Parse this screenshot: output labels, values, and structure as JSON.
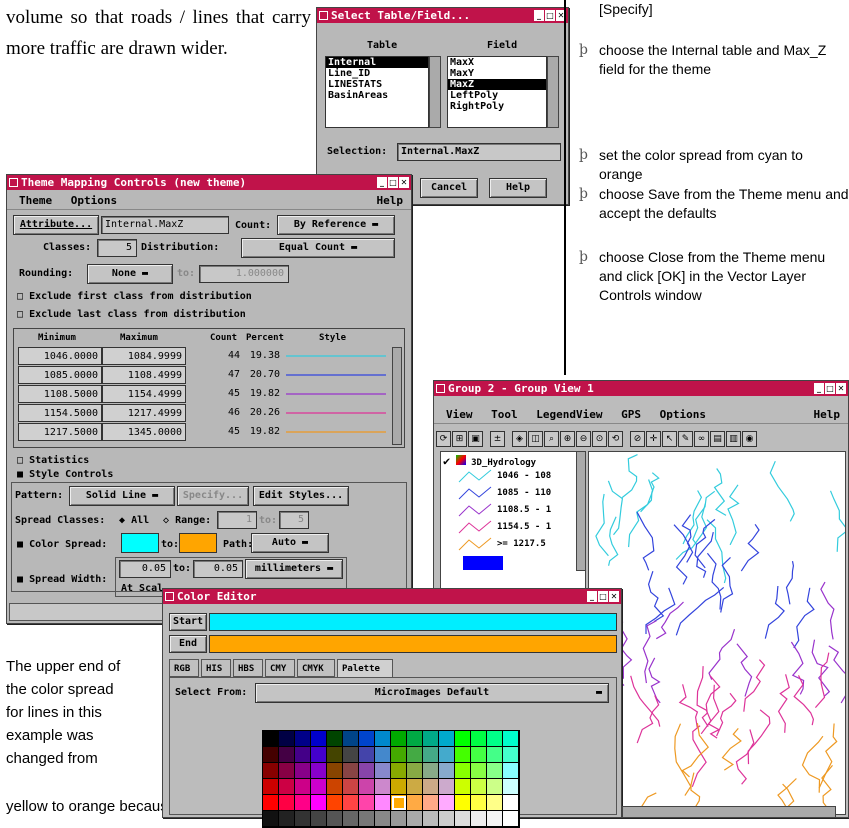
{
  "intro_text": "volume so that roads / lines that carry more traffic are drawn wider.",
  "bottom_text": "The upper end of the color spread for lines in this example was changed from",
  "bottom_text2": "yellow to orange because yellow lines on a",
  "right_text": {
    "specify": "[Specify]",
    "bullets": [
      "choose the Internal table and Max_Z field for the theme",
      "set the color spread from cyan to orange",
      "choose Save from the Theme menu and accept the defaults",
      "choose Close from the Theme menu and click [OK] in the Vector Layer Controls window"
    ],
    "bullet_mark": "þ"
  },
  "select_dialog": {
    "title": "Select Table/Field...",
    "table_header": "Table",
    "field_header": "Field",
    "tables": [
      "Internal",
      "Line_ID",
      "LINESTATS",
      "BasinAreas"
    ],
    "selected_table": "Internal",
    "fields": [
      "MaxX",
      "MaxY",
      "MaxZ",
      "LeftPoly",
      "RightPoly"
    ],
    "selected_field": "MaxZ",
    "selection_label": "Selection:",
    "selection_value": "Internal.MaxZ",
    "cancel": "Cancel",
    "help": "Help"
  },
  "theme_dialog": {
    "title": "Theme Mapping Controls (new theme)",
    "menu": [
      "Theme",
      "Options"
    ],
    "help": "Help",
    "attribute_btn": "Attribute...",
    "attribute_value": "Internal.MaxZ",
    "count_label": "Count:",
    "count_value": "By Reference",
    "classes_label": "Classes:",
    "classes_value": "5",
    "distribution_label": "Distribution:",
    "distribution_value": "Equal Count",
    "rounding_label": "Rounding:",
    "rounding_value": "None",
    "to_label": "to:",
    "rounding_to": "1.000000",
    "exclude_first": "Exclude first class from distribution",
    "exclude_last": "Exclude last class from distribution",
    "headers": [
      "Minimum",
      "Maximum",
      "Count",
      "Percent",
      "Style"
    ],
    "rows": [
      {
        "min": "1046.0000",
        "max": "1084.9999",
        "count": "44",
        "pct": "19.38",
        "color": "#33ccdd"
      },
      {
        "min": "1085.0000",
        "max": "1108.4999",
        "count": "47",
        "pct": "20.70",
        "color": "#3344dd"
      },
      {
        "min": "1108.5000",
        "max": "1154.4999",
        "count": "45",
        "pct": "19.82",
        "color": "#9933cc"
      },
      {
        "min": "1154.5000",
        "max": "1217.4999",
        "count": "46",
        "pct": "20.26",
        "color": "#dd3399"
      },
      {
        "min": "1217.5000",
        "max": "1345.0000",
        "count": "45",
        "pct": "19.82",
        "color": "#ee9922"
      }
    ],
    "statistics": "Statistics",
    "style_controls": "Style Controls",
    "pattern_label": "Pattern:",
    "pattern_value": "Solid Line",
    "specify_btn": "Specify...",
    "edit_styles_btn": "Edit Styles...",
    "spread_classes_label": "Spread Classes:",
    "all_label": "All",
    "range_label": "Range:",
    "range_from": "1",
    "range_to_label": "to:",
    "range_to": "5",
    "color_spread_label": "Color Spread:",
    "color_from": "#00ffff",
    "color_to": "#ffa500",
    "path_label": "Path:",
    "path_value": "Auto",
    "spread_width_label": "Spread Width:",
    "width_from": "0.05",
    "width_to_label": "to:",
    "width_to": "0.05",
    "width_units": "millimeters",
    "at_scale_label": "At Scal"
  },
  "group_dialog": {
    "title": "Group 2 - Group View 1",
    "menu": [
      "View",
      "Tool",
      "LegendView",
      "GPS",
      "Options"
    ],
    "help": "Help",
    "layer_name": "3D_Hydrology",
    "legend": [
      {
        "label": "1046 - 108",
        "color": "#33ccdd"
      },
      {
        "label": "1085 - 110",
        "color": "#3344dd"
      },
      {
        "label": "1108.5 - 1",
        "color": "#9933cc"
      },
      {
        "label": "1154.5 - 1",
        "color": "#dd3399"
      },
      {
        "label": ">= 1217.5",
        "color": "#ee9922"
      }
    ],
    "swatch_color": "#0000ff"
  },
  "color_editor": {
    "title": "Color Editor",
    "start_label": "Start",
    "end_label": "End",
    "start_color": "#00eeff",
    "end_color": "#ffa500",
    "tabs": [
      "RGB",
      "HIS",
      "HBS",
      "CMY",
      "CMYK",
      "Palette"
    ],
    "active_tab": "Palette",
    "select_from_label": "Select From:",
    "select_from_value": "MicroImages Default"
  }
}
